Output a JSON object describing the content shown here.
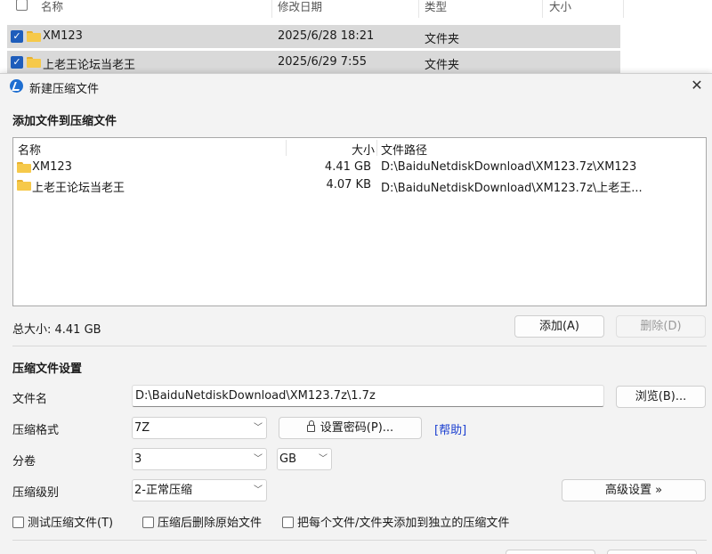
{
  "explorer": {
    "columns": [
      "名称",
      "修改日期",
      "类型",
      "大小"
    ],
    "rows": [
      {
        "name": "XM123",
        "date": "2025/6/28 18:21",
        "type": "文件夹"
      },
      {
        "name": "上老王论坛当老王",
        "date": "2025/6/29 7:55",
        "type": "文件夹"
      }
    ]
  },
  "dialog": {
    "title": "新建压缩文件",
    "close_glyph": "✕",
    "add_section_title": "添加文件到压缩文件",
    "file_list": {
      "headers": {
        "name": "名称",
        "size": "大小",
        "path": "文件路径"
      },
      "rows": [
        {
          "name": "XM123",
          "size": "4.41 GB",
          "path": "D:\\BaiduNetdiskDownload\\XM123.7z\\XM123"
        },
        {
          "name": "上老王论坛当老王",
          "size": "4.07 KB",
          "path": "D:\\BaiduNetdiskDownload\\XM123.7z\\上老王..."
        }
      ]
    },
    "total_size": "总大小: 4.41 GB",
    "add_button": "添加(A)",
    "delete_button": "删除(D)",
    "settings_title": "压缩文件设置",
    "filename_label": "文件名",
    "filename_value": "D:\\BaiduNetdiskDownload\\XM123.7z\\1.7z",
    "browse_button": "浏览(B)...",
    "format_label": "压缩格式",
    "format_value": "7Z",
    "password_button": "设置密码(P)...",
    "help_link": "[帮助]",
    "volume_label": "分卷",
    "volume_value": "3",
    "volume_unit": "GB",
    "level_label": "压缩级别",
    "level_value": "2-正常压缩",
    "advanced_button": "高级设置 »",
    "options": [
      {
        "label": "测试压缩文件(T)",
        "checked": false
      },
      {
        "label": "压缩后删除原始文件",
        "checked": false
      },
      {
        "label": "把每个文件/文件夹添加到独立的压缩文件",
        "checked": false
      }
    ],
    "chevron_glyph": "﹀"
  },
  "colors": {
    "accent": "#1e5dbb",
    "link": "#1b3fd0",
    "dialog_bg": "#f3f3f3",
    "selected_row": "#d9d9d9"
  },
  "icons": [
    "checkbox-checked-icon",
    "folder-icon",
    "app-icon",
    "close-icon",
    "lock-icon",
    "chevron-down-icon"
  ]
}
